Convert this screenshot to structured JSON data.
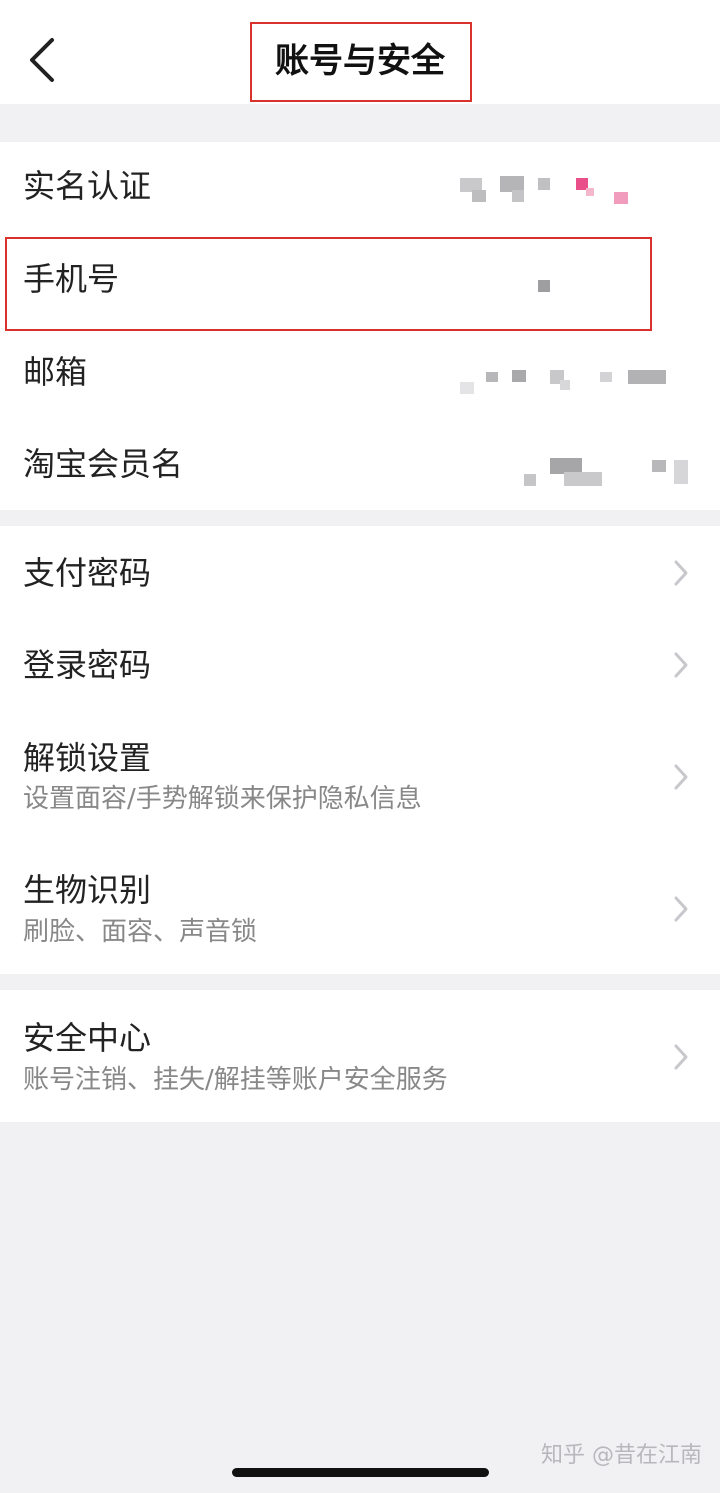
{
  "header": {
    "title": "账号与安全",
    "back_icon": "chevron-left-icon"
  },
  "account_info": [
    {
      "label": "实名认证"
    },
    {
      "label": "手机号"
    },
    {
      "label": "邮箱"
    },
    {
      "label": "淘宝会员名"
    }
  ],
  "security_settings": [
    {
      "label": "支付密码"
    },
    {
      "label": "登录密码"
    },
    {
      "label": "解锁设置",
      "subtitle": "设置面容/手势解锁来保护隐私信息"
    },
    {
      "label": "生物识别",
      "subtitle": "刷脸、面容、声音锁"
    }
  ],
  "security_center": {
    "label": "安全中心",
    "subtitle": "账号注销、挂失/解挂等账户安全服务"
  },
  "watermark": "知乎 @昔在江南",
  "colors": {
    "highlight_border": "#d9322d",
    "background": "#f1f1f3",
    "row_background": "#ffffff",
    "subtitle_text": "#888888"
  }
}
